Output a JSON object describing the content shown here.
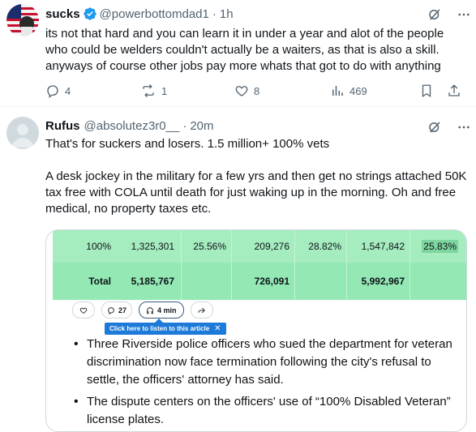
{
  "post1": {
    "display_name": "sucks",
    "handle": "@powerbottomdad1",
    "separator": "·",
    "time": "1h",
    "text": "its not that hard and you can learn it in under a year and alot of the people who could be welders couldn't actually be a waiters, as that is also a skill. anyways of course other jobs pay more whats that got to do with anything",
    "replies": "4",
    "reposts": "1",
    "likes": "8",
    "views": "469"
  },
  "post2": {
    "display_name": "Rufus",
    "handle": "@absolutez3r0__",
    "separator": "·",
    "time": "20m",
    "paragraph1": "That's for suckers and losers. 1.5 million+ 100% vets",
    "paragraph2": "A desk jockey in the military for a few yrs and then get no strings attached 50K tax free with COLA until death for just waking up in the morning. Oh and free medical, no property taxes etc."
  },
  "media": {
    "rows": [
      {
        "c0": "100%",
        "c1": "1,325,301",
        "c2": "25.56%",
        "c3": "209,276",
        "c4": "28.82%",
        "c5": "1,547,842",
        "c6": "25.83%"
      },
      {
        "c0": "Total",
        "c1": "5,185,767",
        "c2": "",
        "c3": "726,091",
        "c4": "",
        "c5": "5,992,967",
        "c6": ""
      }
    ],
    "toolbar": {
      "comments": "27",
      "listen": "4 min"
    },
    "tooltip": "Click here to listen to this article",
    "bullets": [
      "Three Riverside police officers who sued the department for veteran discrimination now face termination following the city's refusal to settle, the officers' attorney has said.",
      "The dispute centers on the officers' use of “100% Disabled Veteran” license plates."
    ]
  },
  "colors": {
    "table_bg": "#a5ecbf",
    "verified": "#1d9bf0",
    "muted": "#536471"
  }
}
